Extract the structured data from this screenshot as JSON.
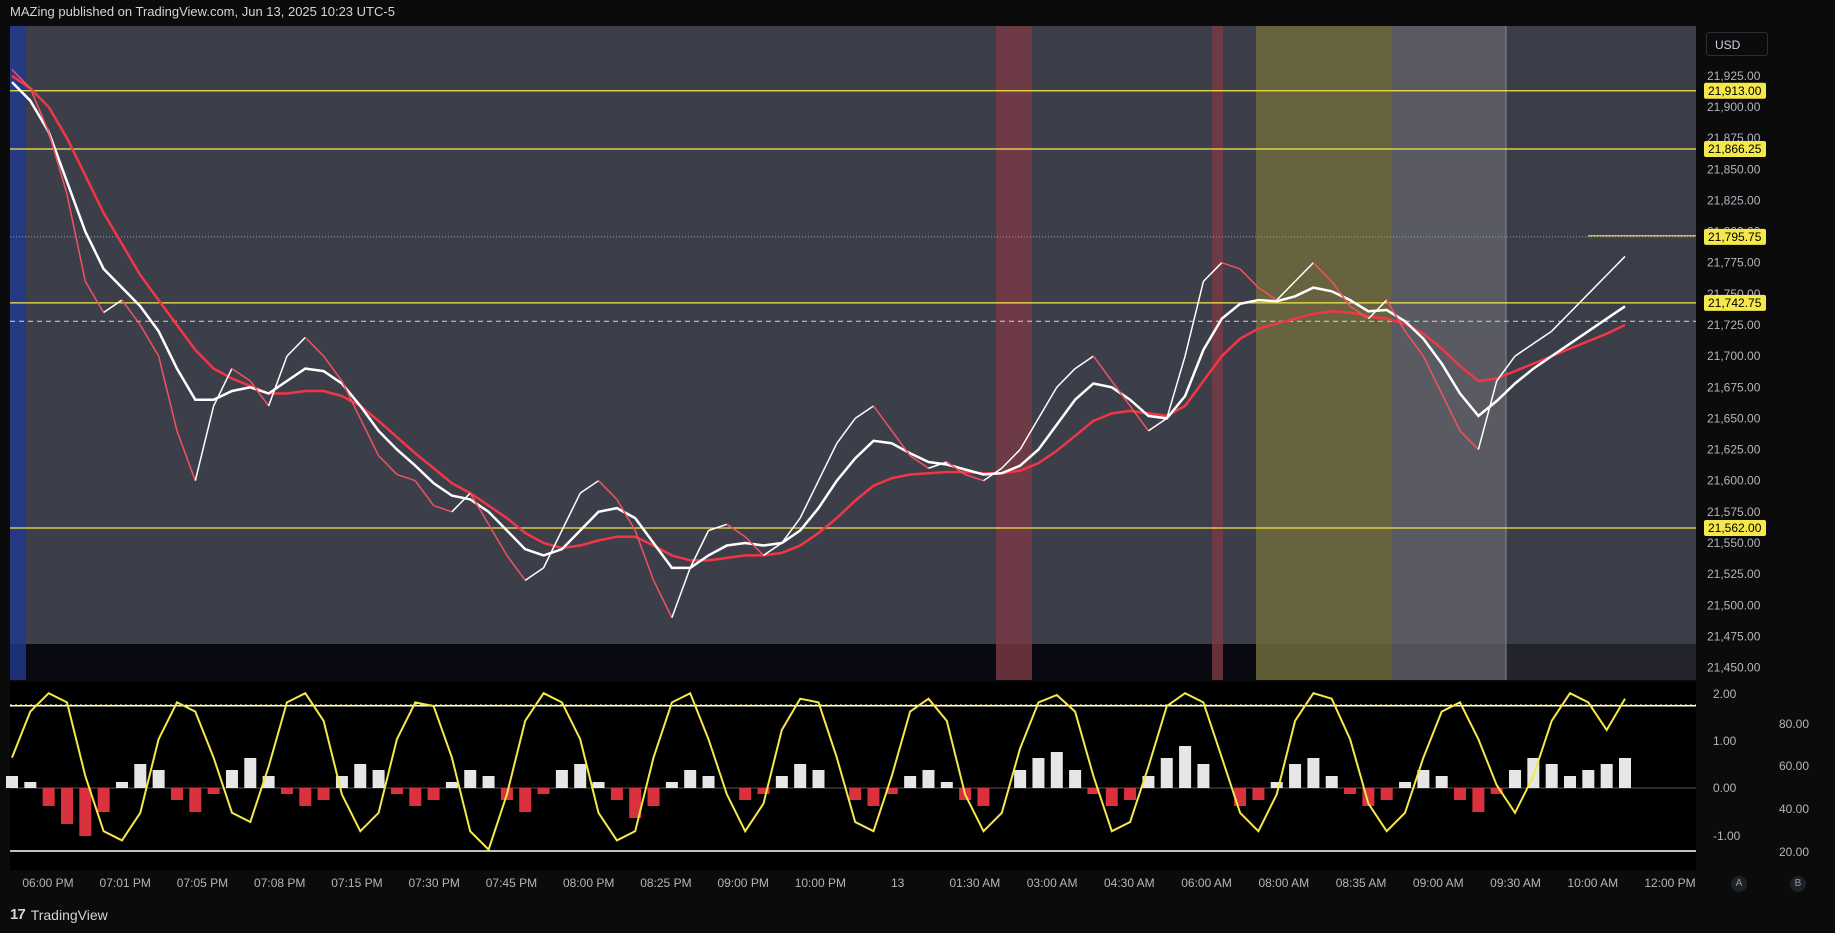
{
  "header": {
    "published": "MAZing published on TradingView.com, Jun 13, 2025 10:23 UTC-5"
  },
  "footer": {
    "brand": "TradingView",
    "logo_glyph": "17"
  },
  "currency": "USD",
  "buttons": {
    "auto": "A",
    "log": "B"
  },
  "chart_data": [
    {
      "type": "line",
      "title": "",
      "price_axis": [
        "21,925.00",
        "21,900.00",
        "21,875.00",
        "21,850.00",
        "21,825.00",
        "21,800.00",
        "21,775.00",
        "21,750.00",
        "21,725.00",
        "21,700.00",
        "21,675.00",
        "21,650.00",
        "21,625.00",
        "21,600.00",
        "21,575.00",
        "21,550.00",
        "21,525.00",
        "21,500.00",
        "21,475.00",
        "21,450.00"
      ],
      "ylim": [
        21440,
        21965
      ],
      "levels": [
        {
          "value": 21913.0,
          "label": "21,913.00"
        },
        {
          "value": 21866.25,
          "label": "21,866.25"
        },
        {
          "value": 21742.75,
          "label": "21,742.75"
        },
        {
          "value": 21562.0,
          "label": "21,562.00"
        }
      ],
      "last_price": {
        "value": 21795.75,
        "label": "21,795.75"
      },
      "dashed_level": 21728,
      "x_labels": [
        "06:00 PM",
        "07:01 PM",
        "07:05 PM",
        "07:08 PM",
        "07:15 PM",
        "07:30 PM",
        "07:45 PM",
        "08:00 PM",
        "08:25 PM",
        "09:00 PM",
        "10:00 PM",
        "13",
        "01:30 AM",
        "03:00 AM",
        "04:30 AM",
        "06:00 AM",
        "08:00 AM",
        "08:35 AM",
        "09:00 AM",
        "09:30 AM",
        "10:00 AM",
        "12:00 PM"
      ],
      "price_series": [
        21930,
        21915,
        21880,
        21830,
        21760,
        21735,
        21745,
        21725,
        21700,
        21640,
        21600,
        21660,
        21690,
        21680,
        21660,
        21700,
        21715,
        21700,
        21680,
        21650,
        21620,
        21605,
        21600,
        21580,
        21575,
        21590,
        21565,
        21540,
        21520,
        21530,
        21560,
        21590,
        21600,
        21585,
        21560,
        21520,
        21490,
        21530,
        21560,
        21565,
        21555,
        21540,
        21550,
        21570,
        21600,
        21630,
        21650,
        21660,
        21640,
        21620,
        21610,
        21615,
        21605,
        21600,
        21610,
        21625,
        21650,
        21675,
        21690,
        21700,
        21680,
        21660,
        21640,
        21650,
        21700,
        21760,
        21775,
        21770,
        21755,
        21745,
        21760,
        21775,
        21760,
        21740,
        21730,
        21745,
        21720,
        21700,
        21670,
        21640,
        21625,
        21680,
        21700,
        21710,
        21720,
        21735,
        21750,
        21765,
        21780
      ],
      "ema_fast": [
        21920,
        21905,
        21880,
        21840,
        21800,
        21770,
        21755,
        21740,
        21720,
        21690,
        21665,
        21665,
        21672,
        21675,
        21670,
        21680,
        21690,
        21688,
        21678,
        21660,
        21640,
        21625,
        21612,
        21598,
        21588,
        21585,
        21575,
        21560,
        21545,
        21540,
        21545,
        21560,
        21575,
        21578,
        21570,
        21550,
        21530,
        21530,
        21540,
        21548,
        21550,
        21548,
        21550,
        21560,
        21578,
        21600,
        21618,
        21632,
        21630,
        21622,
        21615,
        21613,
        21609,
        21605,
        21606,
        21612,
        21625,
        21645,
        21665,
        21678,
        21675,
        21665,
        21652,
        21650,
        21668,
        21705,
        21730,
        21742,
        21745,
        21744,
        21748,
        21755,
        21752,
        21745,
        21736,
        21737,
        21728,
        21714,
        21694,
        21670,
        21652,
        21664,
        21678,
        21690,
        21700,
        21710,
        21720,
        21730,
        21740
      ],
      "ema_slow": [
        21925,
        21915,
        21900,
        21875,
        21845,
        21815,
        21790,
        21765,
        21745,
        21725,
        21705,
        21690,
        21682,
        21676,
        21670,
        21670,
        21672,
        21672,
        21668,
        21660,
        21648,
        21635,
        21622,
        21610,
        21598,
        21590,
        21580,
        21570,
        21558,
        21550,
        21546,
        21548,
        21552,
        21555,
        21555,
        21548,
        21540,
        21536,
        21536,
        21538,
        21540,
        21540,
        21542,
        21548,
        21558,
        21570,
        21584,
        21596,
        21602,
        21605,
        21606,
        21607,
        21607,
        21606,
        21606,
        21608,
        21614,
        21624,
        21636,
        21648,
        21654,
        21656,
        21654,
        21652,
        21660,
        21680,
        21700,
        21714,
        21722,
        21726,
        21730,
        21734,
        21736,
        21735,
        21732,
        21730,
        21726,
        21718,
        21706,
        21692,
        21680,
        21682,
        21688,
        21694,
        21700,
        21706,
        21712,
        21718,
        21725
      ],
      "highlight_bands": [
        {
          "name": "session-start",
          "color": "#1f3a8f"
        },
        {
          "name": "red-band-1",
          "color": "#7a3a44"
        },
        {
          "name": "red-band-2",
          "color": "#7a3a44"
        },
        {
          "name": "yellow-band",
          "color": "#6d6a3c"
        },
        {
          "name": "gray-band",
          "color": "#5e5f66"
        }
      ],
      "colors": {
        "price_up": "#ffffff",
        "price_down": "#f2525f",
        "ema_fast": "#ffffff",
        "ema_slow": "#f23645",
        "level": "#f5e84a"
      }
    },
    {
      "type": "line",
      "title": "",
      "left_axis": [
        "2.00",
        "1.00",
        "0.00",
        "-1.00"
      ],
      "right_axis": [
        "80.00",
        "60.00",
        "40.00",
        "20.00"
      ],
      "oscillator": [
        60,
        85,
        95,
        90,
        50,
        20,
        15,
        30,
        70,
        90,
        85,
        60,
        30,
        25,
        55,
        90,
        95,
        80,
        40,
        20,
        30,
        70,
        90,
        88,
        60,
        20,
        10,
        40,
        80,
        95,
        90,
        70,
        30,
        15,
        20,
        60,
        90,
        95,
        70,
        40,
        20,
        35,
        75,
        92,
        90,
        60,
        25,
        20,
        50,
        85,
        92,
        80,
        40,
        20,
        30,
        65,
        90,
        94,
        85,
        50,
        20,
        25,
        55,
        88,
        95,
        90,
        60,
        30,
        20,
        40,
        80,
        95,
        92,
        70,
        35,
        20,
        30,
        60,
        85,
        90,
        70,
        45,
        30,
        50,
        80,
        95,
        90,
        75,
        92
      ],
      "histogram": [
        0.2,
        0.1,
        -0.3,
        -0.6,
        -0.8,
        -0.4,
        0.1,
        0.4,
        0.3,
        -0.2,
        -0.4,
        -0.1,
        0.3,
        0.5,
        0.2,
        -0.1,
        -0.3,
        -0.2,
        0.2,
        0.4,
        0.3,
        -0.1,
        -0.3,
        -0.2,
        0.1,
        0.3,
        0.2,
        -0.2,
        -0.4,
        -0.1,
        0.3,
        0.4,
        0.1,
        -0.2,
        -0.5,
        -0.3,
        0.1,
        0.3,
        0.2,
        0.0,
        -0.2,
        -0.1,
        0.2,
        0.4,
        0.3,
        0.0,
        -0.2,
        -0.3,
        -0.1,
        0.2,
        0.3,
        0.1,
        -0.2,
        -0.3,
        0.0,
        0.3,
        0.5,
        0.6,
        0.3,
        -0.1,
        -0.3,
        -0.2,
        0.2,
        0.5,
        0.7,
        0.4,
        0.0,
        -0.3,
        -0.2,
        0.1,
        0.4,
        0.5,
        0.2,
        -0.1,
        -0.3,
        -0.2,
        0.1,
        0.3,
        0.2,
        -0.2,
        -0.4,
        -0.1,
        0.3,
        0.5,
        0.4,
        0.2,
        0.3,
        0.4,
        0.5
      ],
      "dotted_level": 2.0,
      "solid_levels": [
        80,
        20
      ]
    }
  ]
}
